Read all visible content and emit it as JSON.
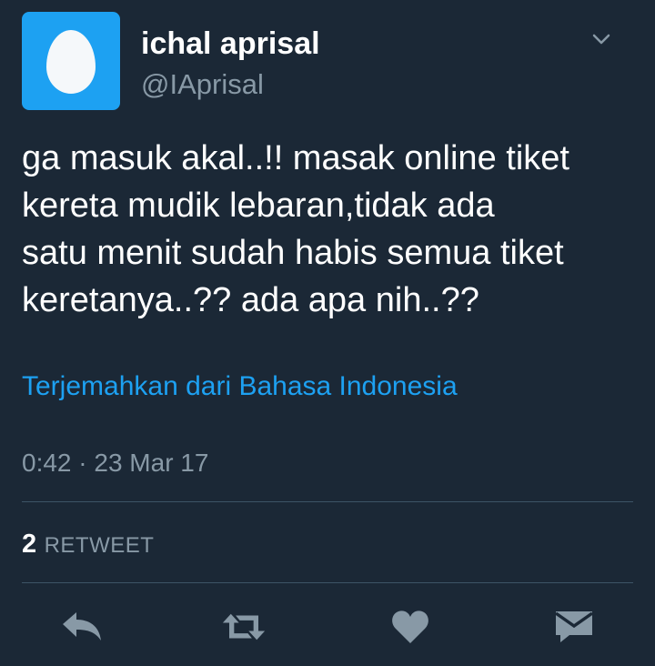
{
  "author": {
    "display_name": "ichal aprisal",
    "handle": "@IAprisal",
    "avatar_icon": "default-egg-avatar"
  },
  "menu": {
    "icon": "chevron-down-icon"
  },
  "tweet": {
    "text": "ga masuk akal..!! masak online tiket\nkereta mudik lebaran,tidak ada\nsatu menit sudah habis semua tiket\nkeretanya..?? ada apa nih..??",
    "translate_label": "Terjemahkan dari Bahasa Indonesia",
    "timestamp": "0:42 · 23 Mar 17"
  },
  "stats": {
    "retweet_count": "2",
    "retweet_label": "RETWEET"
  },
  "actions": [
    {
      "name": "reply",
      "icon": "reply-icon"
    },
    {
      "name": "retweet",
      "icon": "retweet-icon"
    },
    {
      "name": "like",
      "icon": "heart-icon"
    },
    {
      "name": "direct-message",
      "icon": "message-icon"
    }
  ],
  "colors": {
    "background": "#1b2836",
    "accent": "#1da1f2",
    "secondary_text": "#8899a6",
    "divider": "#3d5466",
    "icon": "#8899a6"
  }
}
